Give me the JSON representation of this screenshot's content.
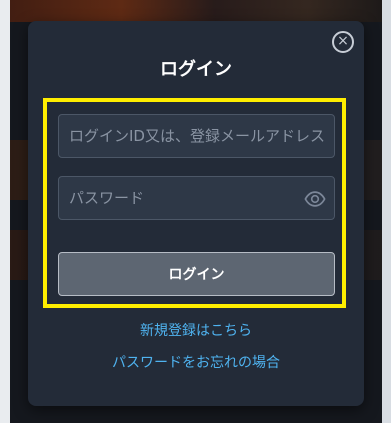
{
  "modal": {
    "title": "ログイン",
    "close_symbol": "×",
    "close_icon": "close-circle-icon"
  },
  "form": {
    "id_field": {
      "placeholder": "ログインID又は、登録メールアドレス",
      "value": ""
    },
    "password_field": {
      "placeholder": "パスワード",
      "value": "",
      "toggle_icon": "eye-icon"
    },
    "submit_label": "ログイン"
  },
  "links": {
    "register": "新規登録はこちら",
    "forgot_password": "パスワードをお忘れの場合"
  },
  "colors": {
    "modal_bg": "#232b38",
    "highlight": "#ffee00",
    "link": "#4fb3f0",
    "button_bg": "#5d6672"
  }
}
